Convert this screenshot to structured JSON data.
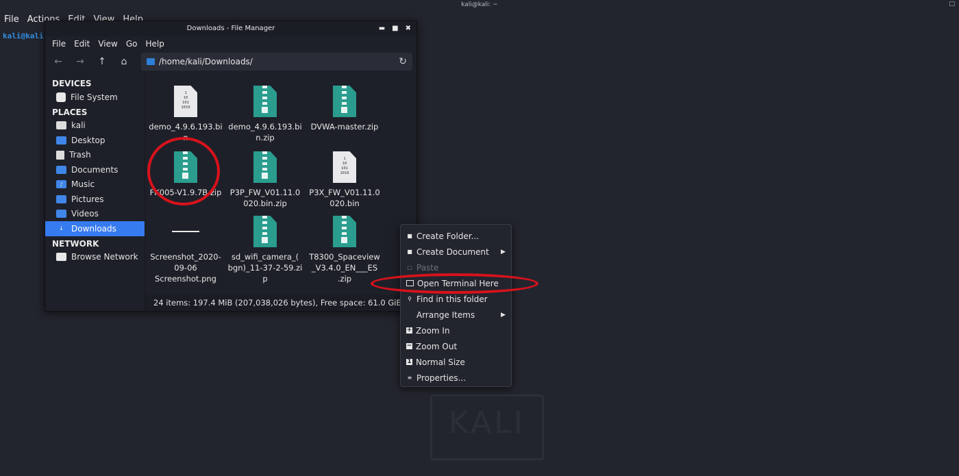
{
  "terminal": {
    "title": "kali@kali: ~",
    "menu": [
      "File",
      "Actions",
      "Edit",
      "View",
      "Help"
    ],
    "prompt": "kali@kali"
  },
  "watermark": {
    "logo": "KALI"
  },
  "file_manager": {
    "title": "Downloads - File Manager",
    "menu": [
      "File",
      "Edit",
      "View",
      "Go",
      "Help"
    ],
    "path": "/home/kali/Downloads/",
    "sidebar": {
      "devices_heading": "DEVICES",
      "devices": [
        {
          "label": "File System",
          "icon": "disk-icon"
        }
      ],
      "places_heading": "PLACES",
      "places": [
        {
          "label": "kali",
          "icon": "home-folder-icon"
        },
        {
          "label": "Desktop",
          "icon": "folder-icon"
        },
        {
          "label": "Trash",
          "icon": "trash-icon"
        },
        {
          "label": "Documents",
          "icon": "folder-icon"
        },
        {
          "label": "Music",
          "icon": "music-folder-icon"
        },
        {
          "label": "Pictures",
          "icon": "pictures-folder-icon"
        },
        {
          "label": "Videos",
          "icon": "video-folder-icon"
        },
        {
          "label": "Downloads",
          "icon": "download-folder-icon",
          "active": true
        }
      ],
      "network_heading": "NETWORK",
      "network": [
        {
          "label": "Browse Network",
          "icon": "network-icon"
        }
      ]
    },
    "files": [
      {
        "name_line1": "demo_4.9.6.193.bi",
        "name_line2": "n",
        "type": "bin"
      },
      {
        "name_line1": "demo_4.9.6.193.bi",
        "name_line2": "n.zip",
        "type": "zip"
      },
      {
        "name_line1": "DVWA-master.zip",
        "name_line2": "",
        "type": "zip"
      },
      {
        "name_line1": "FK005-V1.9.7B.zip",
        "name_line2": "",
        "type": "zip"
      },
      {
        "name_line1": "P3P_FW_V01.11.0",
        "name_line2": "020.bin.zip",
        "type": "zip"
      },
      {
        "name_line1": "P3X_FW_V01.11.0",
        "name_line2": "020.bin",
        "type": "bin"
      },
      {
        "name_line1": "Screenshot_2020-",
        "name_line2": "09-06",
        "name_line3": "Screenshot.png",
        "type": "png"
      },
      {
        "name_line1": "sd_wifi_camera_(",
        "name_line2": "bgn)_11-37-2-59.zi",
        "name_line3": "p",
        "type": "zip"
      },
      {
        "name_line1": "T8300_Spaceview",
        "name_line2": "_V3.4.0_EN___ES",
        "name_line3": ".zip",
        "type": "zip"
      }
    ],
    "bin_glyph": [
      "1",
      "10",
      "101",
      "1010"
    ],
    "status": "24 items: 197.4 MiB (207,038,026 bytes), Free space: 61.0 GiB"
  },
  "context_menu": {
    "items": [
      {
        "label": "Create Folder...",
        "icon": "new-folder-icon",
        "submenu": false,
        "disabled": false
      },
      {
        "label": "Create Document",
        "icon": "new-document-icon",
        "submenu": true,
        "disabled": false
      },
      {
        "label": "Paste",
        "icon": "paste-icon",
        "submenu": false,
        "disabled": true
      },
      {
        "label": "Open Terminal Here",
        "icon": "terminal-icon",
        "submenu": false,
        "disabled": false
      },
      {
        "label": "Find in this folder",
        "icon": "search-icon",
        "submenu": false,
        "disabled": false
      },
      {
        "label": "Arrange Items",
        "icon": "",
        "submenu": true,
        "disabled": false
      },
      {
        "label": "Zoom In",
        "icon": "zoom-in-icon",
        "submenu": false,
        "disabled": false
      },
      {
        "label": "Zoom Out",
        "icon": "zoom-out-icon",
        "submenu": false,
        "disabled": false
      },
      {
        "label": "Normal Size",
        "icon": "normal-size-icon",
        "submenu": false,
        "disabled": false
      },
      {
        "label": "Properties...",
        "icon": "properties-icon",
        "submenu": false,
        "disabled": false
      }
    ]
  },
  "colors": {
    "desktop_bg": "#23252e",
    "accent": "#367bf0",
    "zip_icon": "#2a9d8f",
    "annotation_red": "#d8121b"
  }
}
